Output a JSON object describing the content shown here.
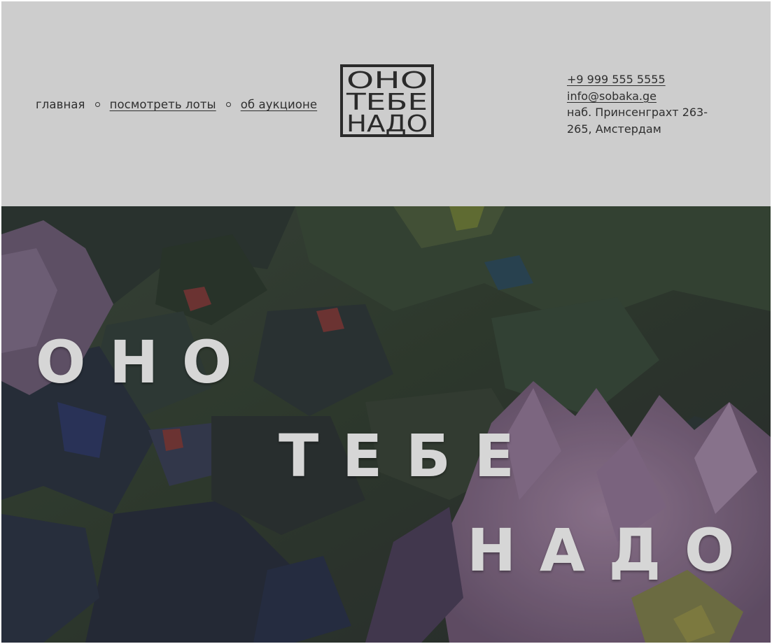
{
  "nav": {
    "items": [
      {
        "label": "главная"
      },
      {
        "label": "посмотреть лоты"
      },
      {
        "label": "об аукционе"
      }
    ]
  },
  "logo": {
    "lines": [
      "ОНО",
      "ТЕБЕ",
      "НАДО"
    ]
  },
  "contacts": {
    "phone": "+9 999 555 5555",
    "email": "info@sobaka.ge",
    "address": "наб. Принсенграхт 263-265, Амстердам"
  },
  "hero": {
    "words": [
      "ОНО",
      "ТЕБЕ",
      "НАДО"
    ]
  },
  "colors": {
    "header_bg": "#cdcdcd",
    "text": "#2f2f2f",
    "hero_text": "#d6d6d6"
  },
  "icons": {
    "separator": "circle-dot-icon"
  }
}
